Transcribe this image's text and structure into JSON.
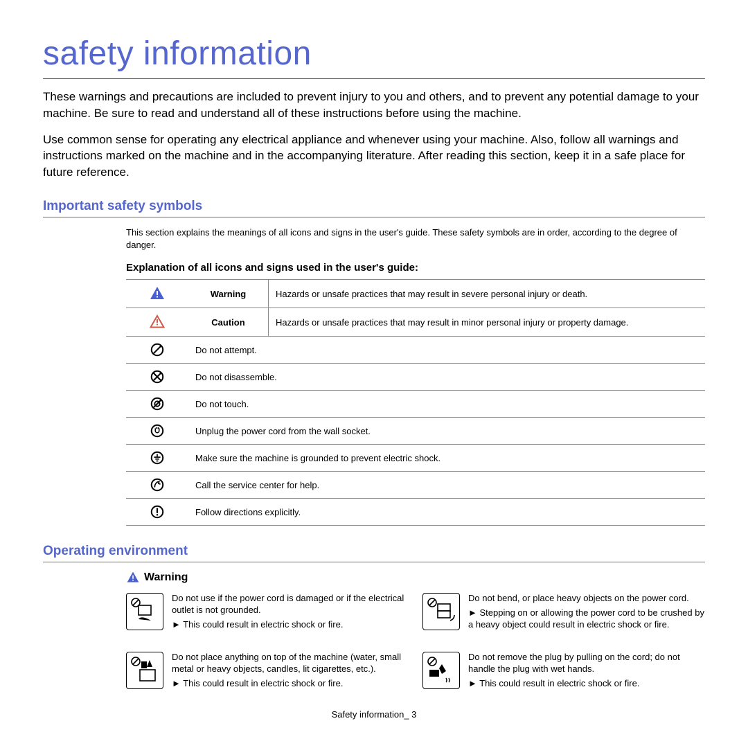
{
  "title": "safety information",
  "intro1": "These warnings and precautions are included to prevent injury to you and others, and to prevent any potential damage to your machine. Be sure to read and understand all of these instructions before using the machine.",
  "intro2": "Use common sense for operating any electrical appliance and whenever using your machine. Also, follow all warnings and instructions marked on the machine and in the accompanying literature. After reading this section, keep it in a safe place for future reference.",
  "symbolsHeading": "Important safety symbols",
  "symbolsNote": "This section explains the meanings of all icons and signs in the user's guide. These safety symbols are in order, according to the degree of danger.",
  "explainHeading": "Explanation of all icons and signs used in the user's guide:",
  "table": {
    "warningLabel": "Warning",
    "warningDesc": "Hazards or unsafe practices that may result in severe personal injury or death.",
    "cautionLabel": "Caution",
    "cautionDesc": "Hazards or unsafe practices that may result in minor personal injury or property damage.",
    "row3": "Do not attempt.",
    "row4": "Do not disassemble.",
    "row5": "Do not touch.",
    "row6": "Unplug the power cord from the wall socket.",
    "row7": "Make sure the machine is grounded to prevent electric shock.",
    "row8": "Call the service center for help.",
    "row9": "Follow directions explicitly."
  },
  "opEnvHeading": "Operating environment",
  "opWarnLabel": "Warning",
  "warnings": {
    "w1a": "Do not use if the power cord is damaged or if the electrical outlet is not grounded.",
    "w1b": "► This could result in electric shock or fire.",
    "w2a": "Do not bend, or place heavy objects on the power cord.",
    "w2b": "► Stepping on or allowing the power cord to be crushed by a heavy object could result in electric shock or fire.",
    "w3a": "Do not place anything on top of the machine (water, small metal or heavy objects, candles, lit cigarettes, etc.).",
    "w3b": "► This could result in electric shock or fire.",
    "w4a": "Do not remove the plug by pulling on the cord; do not handle the plug with wet hands.",
    "w4b": "► This could result in electric shock or fire."
  },
  "footer": "Safety information_ 3"
}
